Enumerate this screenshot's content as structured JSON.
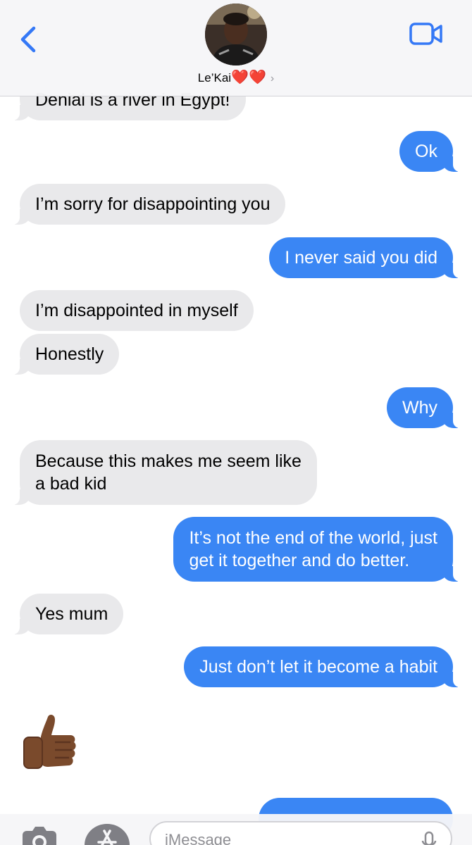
{
  "header": {
    "contact_name": "Le’Kai",
    "hearts": "❤️❤️",
    "chevron": "›",
    "icons": {
      "back": "chevron-left-icon",
      "video": "video-camera-icon"
    },
    "accent_color": "#3478f6"
  },
  "messages": [
    {
      "direction": "received",
      "text": "Denial is a river in Egypt!"
    },
    {
      "direction": "sent",
      "text": "Ok"
    },
    {
      "direction": "received",
      "text": "I’m sorry for disappointing you"
    },
    {
      "direction": "sent",
      "text": "I never said you did"
    },
    {
      "direction": "received",
      "text": "I’m disappointed in myself"
    },
    {
      "direction": "received",
      "text": "Honestly"
    },
    {
      "direction": "sent",
      "text": "Why"
    },
    {
      "direction": "received",
      "lines": [
        "Because this makes me seem like",
        "a bad kid"
      ]
    },
    {
      "direction": "sent",
      "lines": [
        "It’s not the end of the world, just",
        "get it together and do better."
      ]
    },
    {
      "direction": "received",
      "text": "Yes mum"
    },
    {
      "direction": "sent",
      "text": "Just don’t let it become a habit"
    },
    {
      "direction": "received",
      "emoji": "thumbs-up-dark-skin-tone"
    },
    {
      "direction": "sent",
      "text": ""
    }
  ],
  "colors": {
    "sent_bubble": "#3a86f4",
    "received_bubble": "#e9e9eb"
  },
  "input_bar": {
    "placeholder": "iMessage",
    "icons": {
      "camera": "camera-icon",
      "apps": "app-store-icon",
      "mic": "microphone-icon"
    }
  }
}
